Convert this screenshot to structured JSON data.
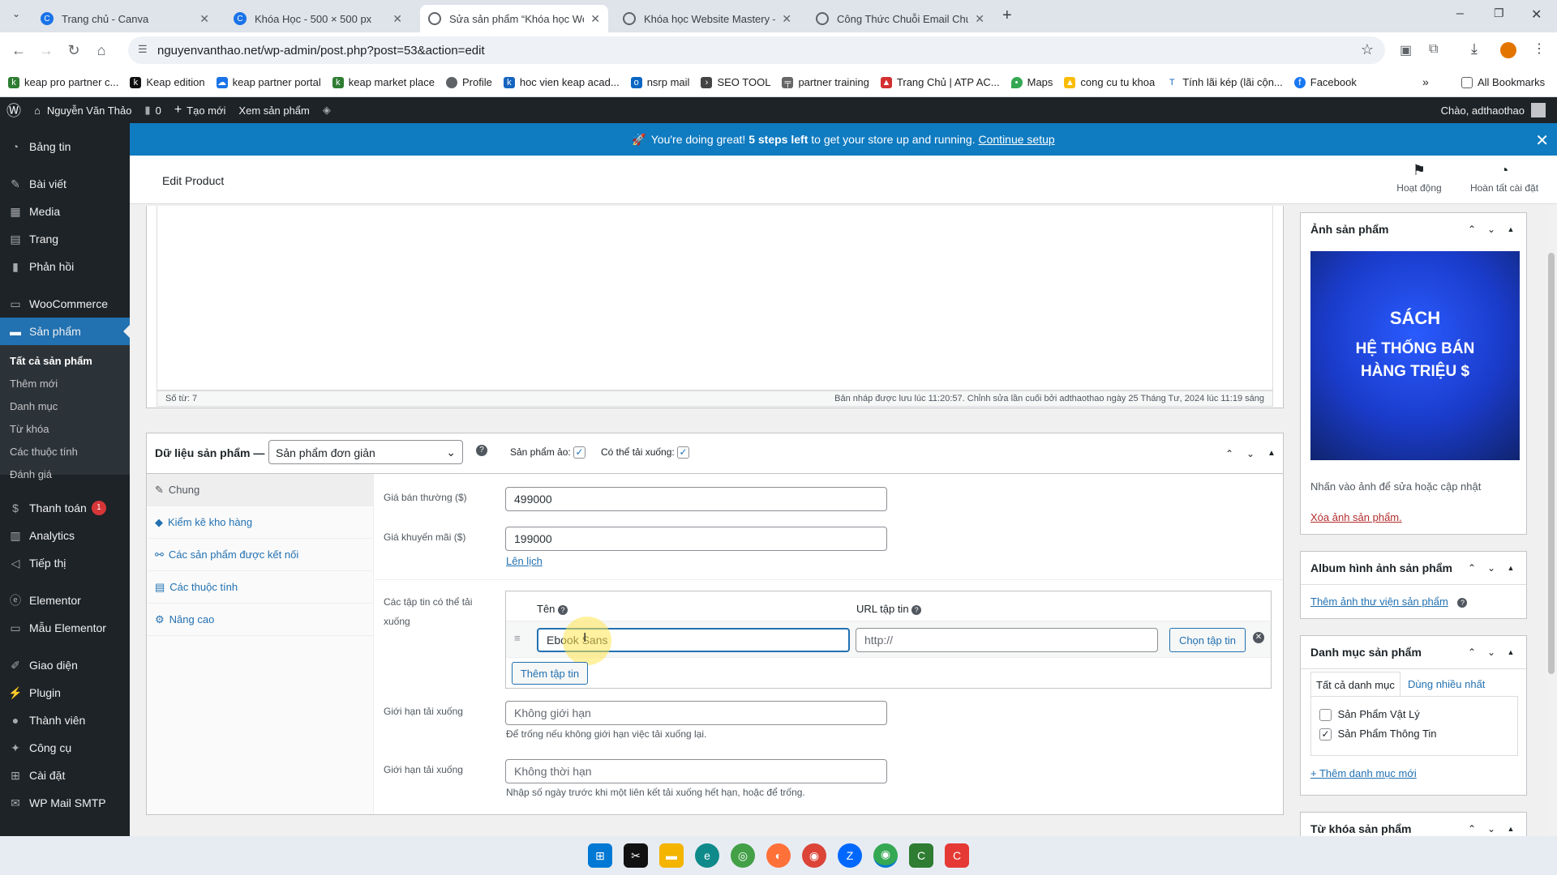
{
  "browser": {
    "tabs": [
      {
        "label": "Trang chủ - Canva",
        "active": false
      },
      {
        "label": "Khóa Học - 500 × 500 px",
        "active": false
      },
      {
        "label": "Sửa sản phẩm “Khóa học Web…",
        "active": true
      },
      {
        "label": "Khóa học Website Mastery – N…",
        "active": false
      },
      {
        "label": "Công Thức Chuỗi Email Chuyể…",
        "active": false
      }
    ],
    "url": "nguyenvanthao.net/wp-admin/post.php?post=53&action=edit",
    "bookmarks": [
      "keap pro partner c...",
      "Keap edition",
      "keap partner portal",
      "keap market place",
      "Profile",
      "hoc vien keap acad...",
      "nsrp mail",
      "SEO TOOL",
      "partner training",
      "Trang Chủ | ATP AC...",
      "Maps",
      "cong cu tu khoa",
      "Tính lãi kép (lãi cộn...",
      "Facebook"
    ],
    "all_bookmarks": "All Bookmarks"
  },
  "adminbar": {
    "site_name": "Nguyễn Văn Thảo",
    "comments": "0",
    "new": "Tạo mới",
    "view": "Xem sản phẩm",
    "greeting": "Chào, adthaothao"
  },
  "sidebar": {
    "items": [
      "Bảng tin",
      "Bài viết",
      "Media",
      "Trang",
      "Phản hồi",
      "WooCommerce",
      "Sản phẩm",
      "Thanh toán",
      "Analytics",
      "Tiếp thị",
      "Elementor",
      "Mẫu Elementor",
      "Giao diện",
      "Plugin",
      "Thành viên",
      "Công cụ",
      "Cài đặt",
      "WP Mail SMTP"
    ],
    "payment_badge": "1",
    "submenu": [
      "Tất cả sản phẩm",
      "Thêm mới",
      "Danh mục",
      "Từ khóa",
      "Các thuộc tính",
      "Đánh giá"
    ]
  },
  "notice": {
    "text_a": "You're doing great! ",
    "text_b": "5 steps left",
    "text_c": " to get your store up and running.",
    "link": "Continue setup"
  },
  "header": {
    "title": "Edit Product",
    "activity": "Hoạt động",
    "finish": "Hoàn tất cài đặt"
  },
  "editor": {
    "word_count": "Số từ: 7",
    "draft_status": "Bản nháp được lưu lúc 11:20:57. Chỉnh sửa lần cuối bởi adthaothao ngày 25 Tháng Tư, 2024 lúc 11:19 sáng"
  },
  "product_data": {
    "heading": "Dữ liệu sản phẩm —",
    "type_value": "Sản phẩm đơn giản",
    "virtual_label": "Sản phẩm ảo:",
    "downloadable_label": "Có thể tải xuống:",
    "tabs": [
      "Chung",
      "Kiểm kê kho hàng",
      "Các sản phẩm được kết nối",
      "Các thuộc tính",
      "Nâng cao"
    ],
    "regular_price_label": "Giá bán thường ($)",
    "regular_price": "499000",
    "sale_price_label": "Giá khuyến mãi ($)",
    "sale_price": "199000",
    "schedule_link": "Lên lịch",
    "files_label": "Các tập tin có thể tải xuống",
    "col_name": "Tên",
    "col_url": "URL tập tin",
    "file_name_value": "Ebook Sans",
    "file_url_placeholder": "http://",
    "choose_file": "Chọn tập tin",
    "add_file": "Thêm tập tin",
    "limit_label": "Giới hạn tải xuống",
    "limit_placeholder": "Không giới hạn",
    "limit_help": "Để trống nếu không giới hạn việc tải xuống lại.",
    "expiry_label": "Giới hạn tải xuống",
    "expiry_placeholder": "Không thời hạn",
    "expiry_help": "Nhập số ngày trước khi một liên kết tải xuống hết hạn, hoặc để trống."
  },
  "product_image": {
    "heading": "Ảnh sản phẩm",
    "image_line1": "SÁCH",
    "image_line2": "HỆ THỐNG BÁN",
    "image_line3": "HÀNG TRIỆU $",
    "hint": "Nhấn vào ảnh để sửa hoặc cập nhật",
    "remove": "Xóa ảnh sản phẩm."
  },
  "gallery": {
    "heading": "Album hình ảnh sản phẩm",
    "add": "Thêm ảnh thư viện sản phẩm"
  },
  "categories": {
    "heading": "Danh mục sản phẩm",
    "tab_all": "Tất cả danh mục",
    "tab_popular": "Dùng nhiều nhất",
    "items": [
      {
        "label": "Sản Phẩm Vật Lý",
        "checked": false
      },
      {
        "label": "Sản Phẩm Thông Tin",
        "checked": true
      }
    ],
    "add": "+ Thêm danh mục mới"
  },
  "tags": {
    "heading": "Từ khóa sản phẩm"
  },
  "colors": {
    "wp_dark": "#1d2327",
    "wp_blue": "#2271b1",
    "notice_blue": "#0f7bc1",
    "image_blue": "#1a3bc9"
  }
}
